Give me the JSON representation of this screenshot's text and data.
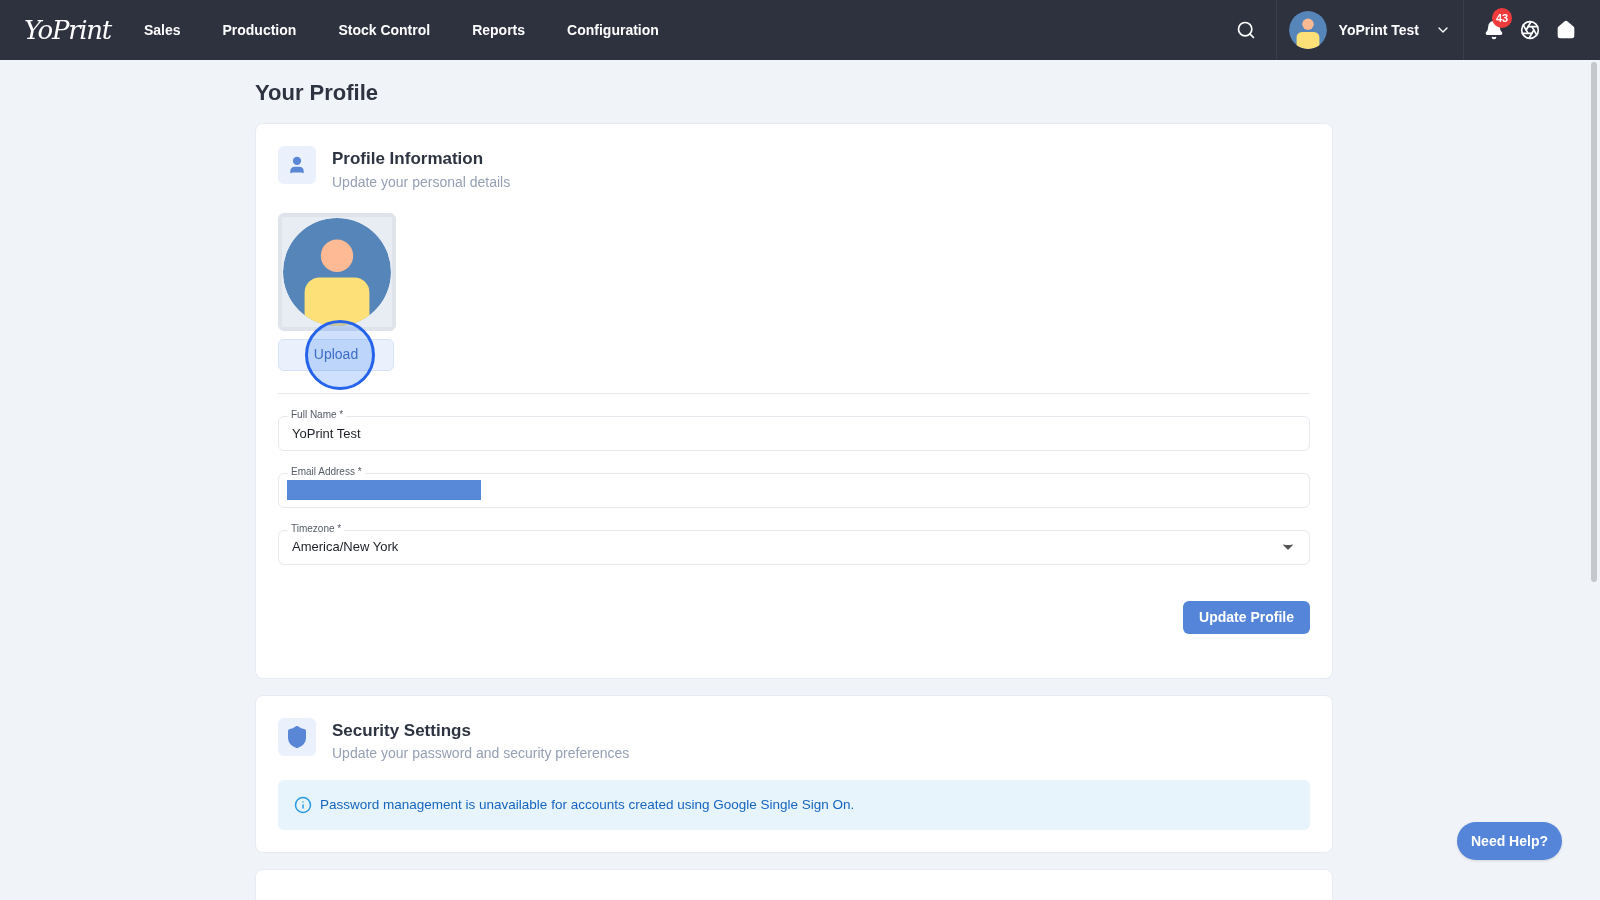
{
  "nav": {
    "logo": "YoPrint",
    "items": [
      "Sales",
      "Production",
      "Stock Control",
      "Reports",
      "Configuration"
    ],
    "user_name": "YoPrint Test",
    "notification_count": "43"
  },
  "page_title": "Your Profile",
  "profile": {
    "title": "Profile Information",
    "subtitle": "Update your personal details",
    "upload_label": "Upload",
    "fields": [
      {
        "kind": "text",
        "label": "Full Name *",
        "value": "YoPrint Test"
      },
      {
        "kind": "redacted",
        "label": "Email Address *"
      },
      {
        "kind": "select",
        "label": "Timezone *",
        "value": "America/New York"
      }
    ],
    "submit": "Update Profile"
  },
  "security": {
    "title": "Security Settings",
    "subtitle": "Update your password and security preferences",
    "notice": "Password management is unavailable for accounts created using Google Single Sign On."
  },
  "help_button": "Need Help?"
}
